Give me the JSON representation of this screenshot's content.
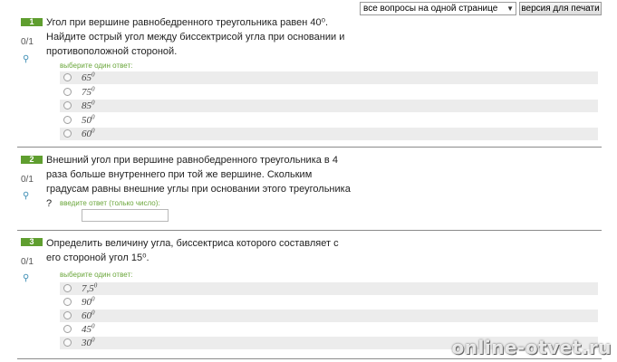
{
  "toolbar": {
    "view_select_value": "все вопросы на одной странице",
    "print_button_label": "версия для печати"
  },
  "questions": [
    {
      "number": "1",
      "score": "0/1",
      "text": "Угол при вершине равнобедренного треугольника равен 40⁰. Найдите острый угол между биссектрисой угла при основании и противоположной стороной.",
      "prompt": "выберите один ответ:",
      "options": [
        {
          "value": "65",
          "sup": "0"
        },
        {
          "value": "75",
          "sup": "0"
        },
        {
          "value": "85",
          "sup": "0"
        },
        {
          "value": "50",
          "sup": "0"
        },
        {
          "value": "60",
          "sup": "0"
        }
      ]
    },
    {
      "number": "2",
      "score": "0/1",
      "text": "Внешний угол при вершине равнобедренного треугольника в 4 раза больше внутреннего при той же вершине. Скольким градусам равны внешние углы при основании этого треугольника ?",
      "prompt": "введите ответ (только число):",
      "answer_value": ""
    },
    {
      "number": "3",
      "score": "0/1",
      "text": "Определить величину угла, биссектриса которого составляет с его стороной угол  15⁰.",
      "prompt": "выберите один ответ:",
      "options": [
        {
          "value": "7,5",
          "sup": "0"
        },
        {
          "value": "90",
          "sup": "0"
        },
        {
          "value": "60",
          "sup": "0"
        },
        {
          "value": "45",
          "sup": "0"
        },
        {
          "value": "30",
          "sup": "0"
        }
      ]
    }
  ],
  "watermark": "online-otvet.ru"
}
